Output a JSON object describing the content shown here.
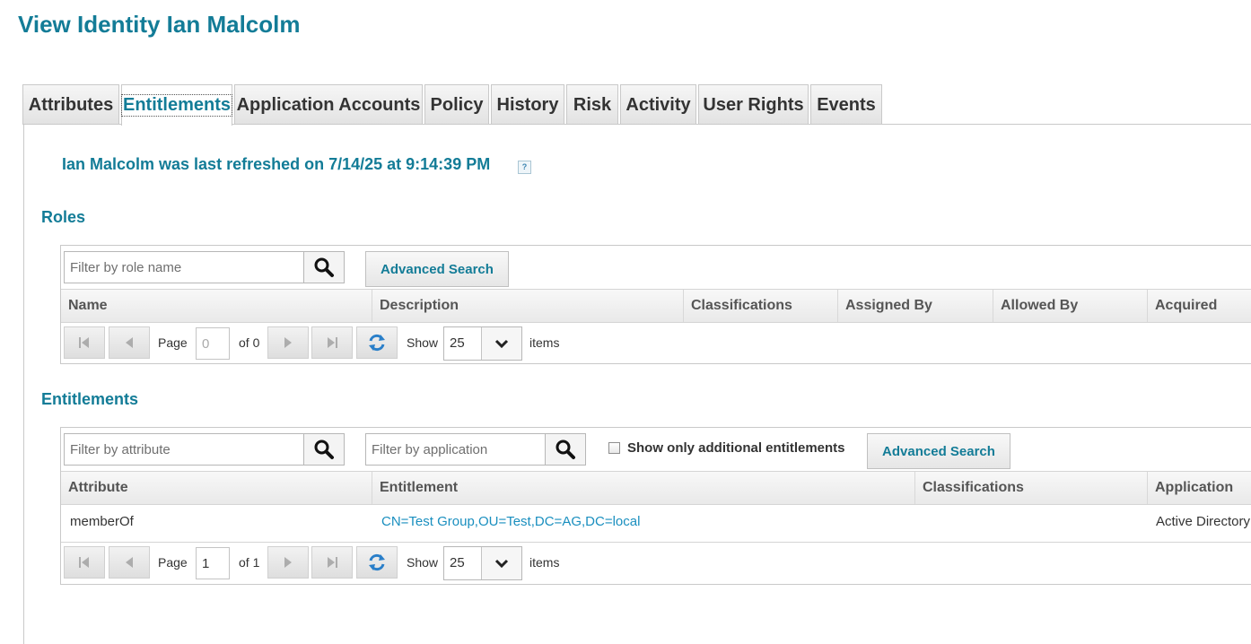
{
  "page": {
    "title": "View Identity Ian Malcolm"
  },
  "tabs": [
    {
      "label": "Attributes"
    },
    {
      "label": "Entitlements",
      "active": true
    },
    {
      "label": "Application Accounts"
    },
    {
      "label": "Policy"
    },
    {
      "label": "History"
    },
    {
      "label": "Risk"
    },
    {
      "label": "Activity"
    },
    {
      "label": "User Rights"
    },
    {
      "label": "Events"
    }
  ],
  "refresh": {
    "text": "Ian Malcolm was last refreshed on 7/14/25 at 9:14:39 PM",
    "help": "?"
  },
  "roles": {
    "title": "Roles",
    "filter_placeholder": "Filter by role name",
    "advanced_search": "Advanced Search",
    "columns": [
      "Name",
      "Description",
      "Classifications",
      "Assigned By",
      "Allowed By",
      "Acquired"
    ],
    "pager": {
      "page_label": "Page",
      "page_value": "0",
      "of_label": "of 0",
      "show_label": "Show",
      "page_size": "25",
      "items_label": "items"
    }
  },
  "entitlements": {
    "title": "Entitlements",
    "attribute_placeholder": "Filter by attribute",
    "application_placeholder": "Filter by application",
    "checkbox_label": "Show only additional entitlements",
    "advanced_search": "Advanced Search",
    "columns": [
      "Attribute",
      "Entitlement",
      "Classifications",
      "Application"
    ],
    "rows": [
      {
        "attribute": "memberOf",
        "entitlement": "CN=Test Group,OU=Test,DC=AG,DC=local",
        "classifications": "",
        "application": "Active Directory"
      }
    ],
    "pager": {
      "page_label": "Page",
      "page_value": "1",
      "of_label": "of 1",
      "show_label": "Show",
      "page_size": "25",
      "items_label": "items"
    }
  },
  "colors": {
    "accent": "#137c97",
    "link": "#1a8fbf"
  }
}
